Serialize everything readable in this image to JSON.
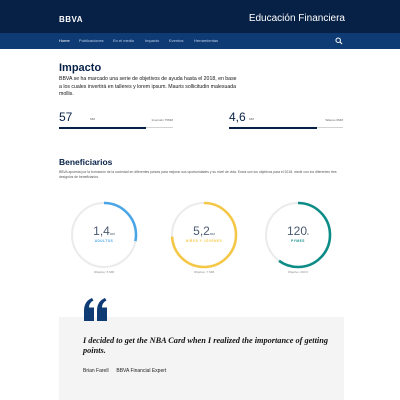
{
  "header": {
    "logo": "BBVA",
    "title": "Educación Financiera"
  },
  "nav": {
    "items": [
      "Home",
      "Publicaciones",
      "En el medio",
      "Impacto",
      "Eventos",
      "Herramientas"
    ],
    "active": "Home"
  },
  "impacto": {
    "title": "Impacto",
    "text": "BBVA se ha marcado una serie de objetivos de ayuda hasta el 2018, en base a los cuales invertirá en talleres y lorem ipsum. Mauris sollicitudin malesuada mollis.",
    "stats": [
      {
        "value": "57",
        "unit": "MM",
        "label": "Inversión 75MM",
        "fill": 0.76
      },
      {
        "value": "4,6",
        "unit": "MM",
        "label": "Talleres 6MM",
        "fill": 0.77
      }
    ]
  },
  "beneficiarios": {
    "title": "Beneficiarios",
    "text": "BBVA apuesta por la formación de la sociedad en diferentes países para mejorar sus oportunidades y su nivel de vida. Estos son los objetivos para el 2018, medir con los diferentes tres designios de beneficiarios.",
    "donuts": [
      {
        "value": "1,4",
        "unit": "MM",
        "label": "ADULTOS",
        "caption": "Objetivo: 5 MM",
        "color": "#49a5e6",
        "fill": 0.28
      },
      {
        "value": "5,2",
        "unit": "MM",
        "label": "NIÑOS Y JÓVENES",
        "caption": "Objetivo: 7 MM",
        "color": "#f5c746",
        "fill": 0.74
      },
      {
        "value": "120",
        "unit": "K",
        "label": "PYMES",
        "caption": "Objetivo: 200 K",
        "color": "#0c8c87",
        "fill": 0.6
      }
    ]
  },
  "quote": {
    "text": "I decided to get the NBA Card when I realized the importance of getting points.",
    "author": "Brian Farell",
    "role": "BBVA Financial Expert"
  },
  "colors": {
    "navy": "#072146",
    "nav_bar": "#0f3b74",
    "light_blue": "#49a5e6",
    "yellow": "#f5c746",
    "teal": "#0c8c87"
  }
}
